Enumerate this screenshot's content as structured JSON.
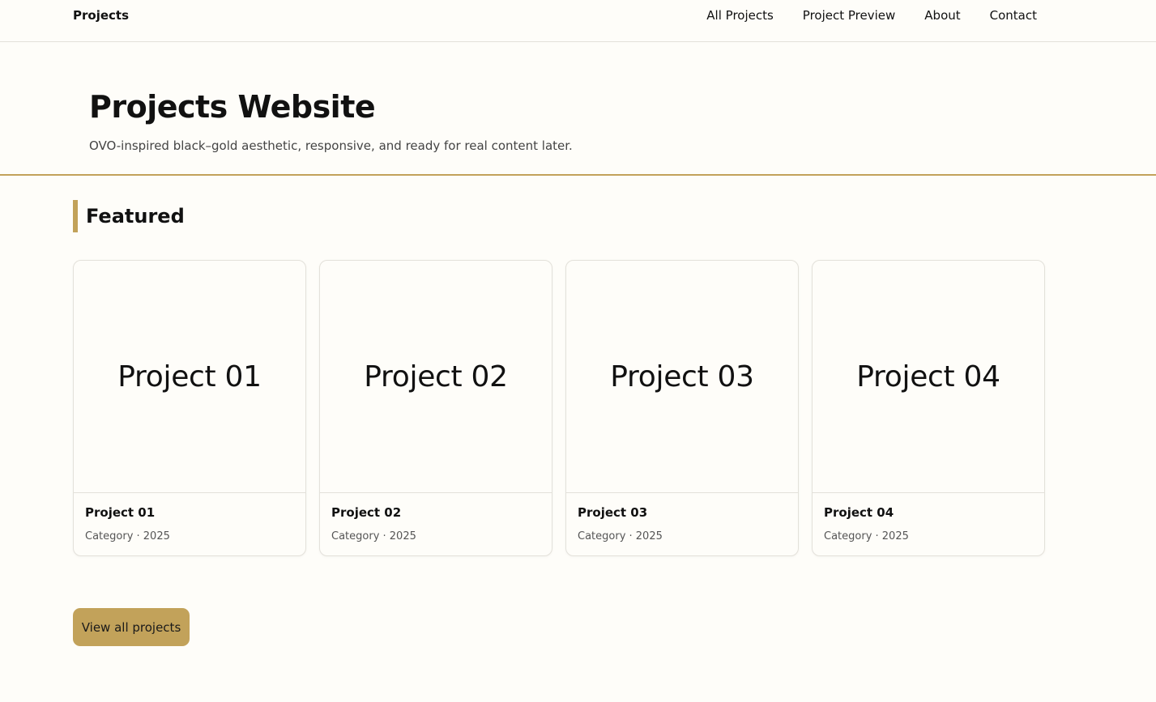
{
  "header": {
    "brand": "Projects",
    "nav": [
      "All Projects",
      "Project Preview",
      "About",
      "Contact"
    ]
  },
  "hero": {
    "title": "Projects Website",
    "subtitle": "OVO-inspired black–gold aesthetic, responsive, and ready for real content later."
  },
  "featured": {
    "heading": "Featured",
    "cards": [
      {
        "media_label": "Project 01",
        "title": "Project 01",
        "meta": "Category · 2025"
      },
      {
        "media_label": "Project 02",
        "title": "Project 02",
        "meta": "Category · 2025"
      },
      {
        "media_label": "Project 03",
        "title": "Project 03",
        "meta": "Category · 2025"
      },
      {
        "media_label": "Project 04",
        "title": "Project 04",
        "meta": "Category · 2025"
      }
    ]
  },
  "cta": {
    "label": "View all projects"
  },
  "colors": {
    "accent": "#c2a25a",
    "background": "#fefdf9",
    "text": "#111111"
  }
}
